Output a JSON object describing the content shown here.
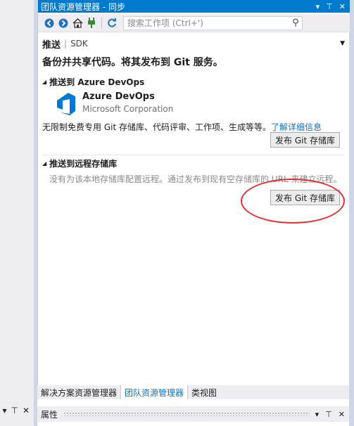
{
  "panel": {
    "title": "团队资源管理器 - 同步",
    "title_controls": {
      "dropdown": "▾",
      "pin": "⊤",
      "close": "✕"
    }
  },
  "toolbar": {
    "search_placeholder": "搜索工作项 (Ctrl+')"
  },
  "page": {
    "heading": "推送",
    "context": "SDK",
    "subtitle": "备份并共享代码。将其发布到 Git 服务。"
  },
  "azure_section": {
    "header": "推送到 Azure DevOps",
    "product_name": "Azure DevOps",
    "publisher": "Microsoft Corporation",
    "description": "无限制免费专用 Git 存储库、代码评审、工作项、生成等等。",
    "learn_more_link": "了解详细信息",
    "publish_button": "发布 Git 存储库"
  },
  "remote_section": {
    "header": "推送到远程存储库",
    "description": "没有为该本地存储库配置远程。通过发布到现有空存储库的 URL 来建立远程。",
    "publish_button": "发布 Git 存储库"
  },
  "bottom_tabs": [
    "解决方案资源管理器",
    "团队资源管理器",
    "类视图"
  ],
  "properties": {
    "title": "属性"
  },
  "colors": {
    "accent": "#007acc",
    "link": "#0e70c0",
    "annotation_red": "#e53030",
    "devops_blue": "#0078d4"
  }
}
